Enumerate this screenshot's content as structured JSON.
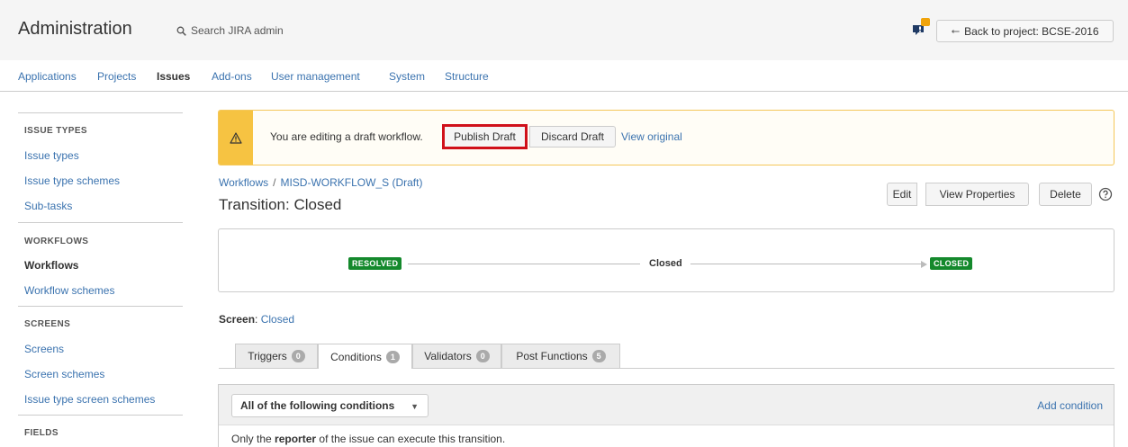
{
  "header": {
    "title": "Administration",
    "search_label": "Search JIRA admin",
    "back_button": "Back to project: BCSE-2016",
    "notification_badge": "1"
  },
  "nav": {
    "items": [
      {
        "label": "Applications",
        "active": false
      },
      {
        "label": "Projects",
        "active": false
      },
      {
        "label": "Issues",
        "active": true
      },
      {
        "label": "Add-ons",
        "active": false
      },
      {
        "label": "User management",
        "active": false
      },
      {
        "label": "System",
        "active": false
      },
      {
        "label": "Structure",
        "active": false
      }
    ]
  },
  "sidebar": {
    "sections": [
      {
        "heading": "ISSUE TYPES",
        "links": [
          "Issue types",
          "Issue type schemes",
          "Sub-tasks"
        ]
      },
      {
        "heading": "WORKFLOWS",
        "links": [
          "Workflows",
          "Workflow schemes"
        ]
      },
      {
        "heading": "SCREENS",
        "links": [
          "Screens",
          "Screen schemes",
          "Issue type screen schemes"
        ]
      },
      {
        "heading": "FIELDS",
        "links": []
      }
    ],
    "active_link": "Workflows"
  },
  "banner": {
    "message": "You are editing a draft workflow.",
    "publish_label": "Publish Draft",
    "discard_label": "Discard Draft",
    "view_original_label": "View original"
  },
  "breadcrumb": {
    "root": "Workflows",
    "separator": "/",
    "current": "MISD-WORKFLOW_S (Draft)"
  },
  "page": {
    "title": "Transition: Closed"
  },
  "actions": {
    "edit": "Edit",
    "view_properties": "View Properties",
    "delete": "Delete"
  },
  "diagram": {
    "from_status": "RESOLVED",
    "transition": "Closed",
    "to_status": "CLOSED",
    "status_color": "#14892c"
  },
  "screen": {
    "label": "Screen",
    "value": "Closed"
  },
  "tabs": [
    {
      "label": "Triggers",
      "count": "0",
      "active": false
    },
    {
      "label": "Conditions",
      "count": "1",
      "active": true
    },
    {
      "label": "Validators",
      "count": "0",
      "active": false
    },
    {
      "label": "Post Functions",
      "count": "5",
      "active": false
    }
  ],
  "conditions": {
    "selector_value": "All of the following conditions",
    "add_label": "Add condition",
    "rule_prefix": "Only the",
    "rule_bold": "reporter",
    "rule_suffix": "of the issue can execute this transition."
  },
  "colors": {
    "link": "#3b73af",
    "warning": "#f6c342",
    "highlight": "#d0101a"
  }
}
